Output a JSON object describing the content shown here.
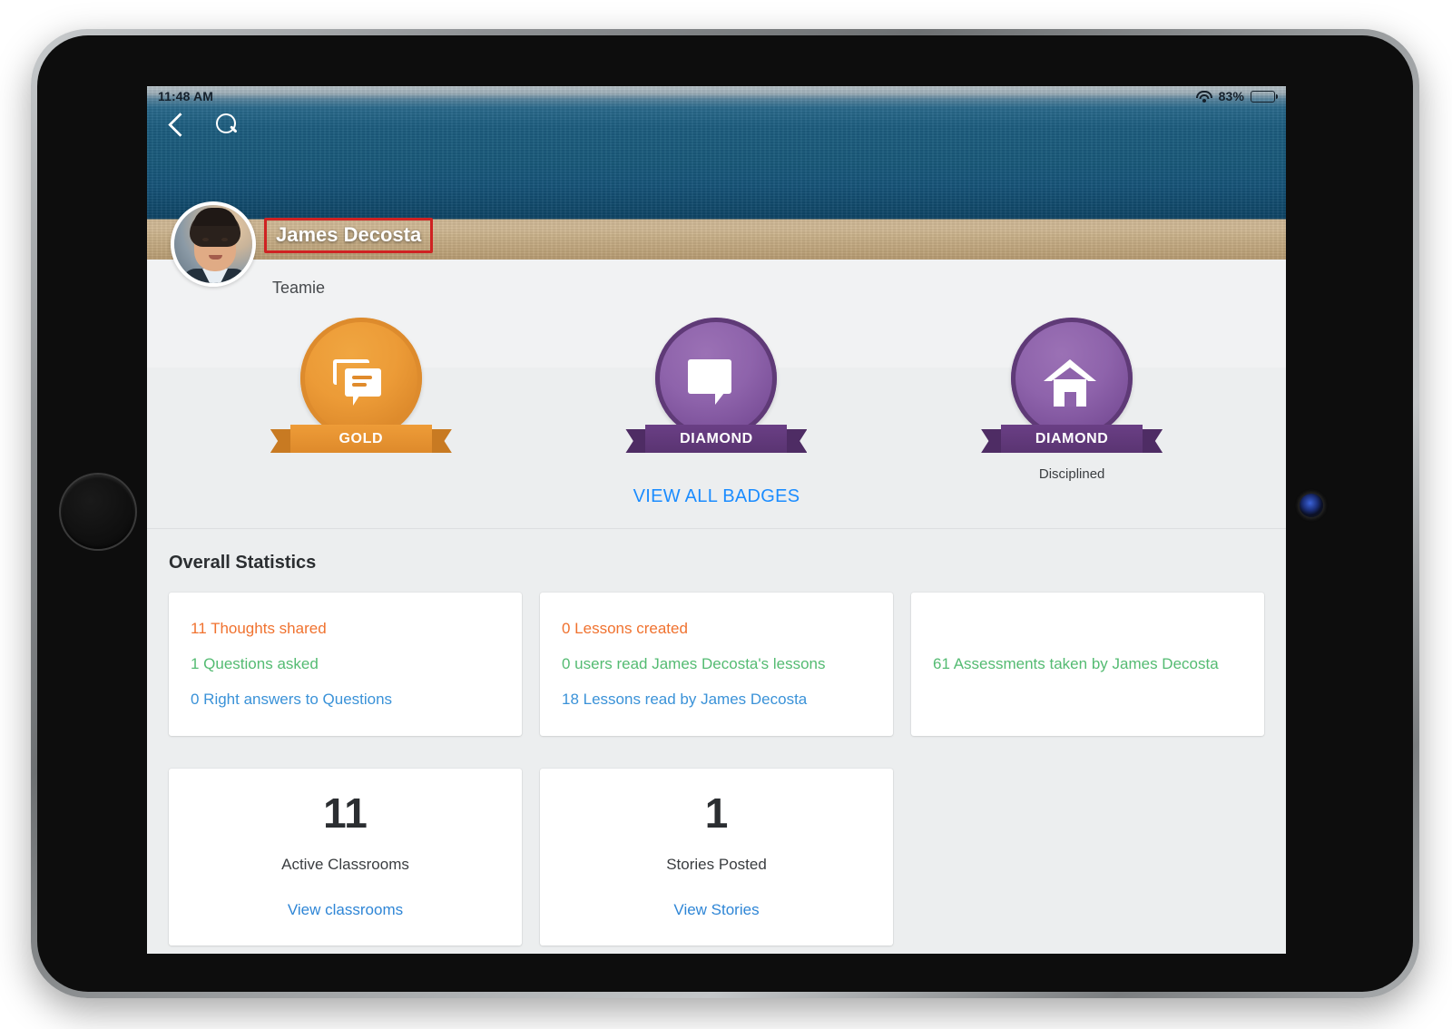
{
  "status_bar": {
    "time": "11:48 AM",
    "battery_percent": "83%",
    "wifi_icon": "wifi-icon",
    "battery_icon": "battery-icon"
  },
  "nav": {
    "back_icon": "chevron-left-icon",
    "search_icon": "search-icon"
  },
  "profile": {
    "name": "James Decosta",
    "subtitle": "Teamie",
    "avatar_alt": "James Decosta profile photo",
    "name_highlight_color": "#cf2222"
  },
  "badges": {
    "items": [
      {
        "tier": "GOLD",
        "caption": "",
        "icon": "chat-bubbles-icon",
        "color": "#e08b2c"
      },
      {
        "tier": "DIAMOND",
        "caption": "",
        "icon": "speech-bubble-icon",
        "color": "#7c519a"
      },
      {
        "tier": "DIAMOND",
        "caption": "Disciplined",
        "icon": "house-icon",
        "color": "#7c519a"
      }
    ],
    "view_all_label": "VIEW ALL BADGES",
    "view_all_color": "#1a8cff"
  },
  "statistics": {
    "section_title": "Overall Statistics",
    "cards": [
      {
        "lines": [
          {
            "text": "11 Thoughts shared",
            "color": "#f0722f"
          },
          {
            "text": "1 Questions asked",
            "color": "#54bb72"
          },
          {
            "text": "0 Right answers to Questions",
            "color": "#3a92d8"
          }
        ]
      },
      {
        "lines": [
          {
            "text": "0 Lessons created",
            "color": "#f0722f"
          },
          {
            "text": "0 users read James Decosta's lessons",
            "color": "#54bb72"
          },
          {
            "text": "18 Lessons read by James Decosta",
            "color": "#3a92d8"
          }
        ]
      },
      {
        "lines": [
          {
            "text": "61 Assessments taken by James Decosta",
            "color": "#54bb72"
          }
        ]
      }
    ],
    "counters": [
      {
        "value": "11",
        "label": "Active Classrooms",
        "link": "View classrooms"
      },
      {
        "value": "1",
        "label": "Stories Posted",
        "link": "View Stories"
      }
    ]
  }
}
